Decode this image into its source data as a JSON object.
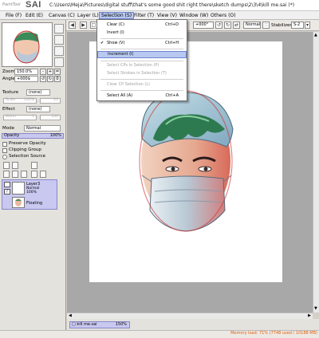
{
  "app": {
    "logo_small": "PaintTool",
    "logo_big": "SAI",
    "title": "C:\\Users\\Meja\\Pictures\\digital stuff\\that's some good shit right there\\sketch dumps\\2\\3\\4\\kill me.sai (*)"
  },
  "menu": [
    {
      "label": "File (F)"
    },
    {
      "label": "Edit (E)"
    },
    {
      "label": "Canvas (C)"
    },
    {
      "label": "Layer (L)"
    },
    {
      "label": "Selection (S)"
    },
    {
      "label": "Filter (T)"
    },
    {
      "label": "View (V)"
    },
    {
      "label": "Window (W)"
    },
    {
      "label": "Others (O)"
    }
  ],
  "toolbar": {
    "zoom_value": "+000°",
    "blend_mode": "Normal",
    "stabilizer_label": "Stabilizer",
    "stabilizer_value": "S-2"
  },
  "dropdown": {
    "items": [
      {
        "label": "Clear (C)",
        "shortcut": "Ctrl+D",
        "enabled": true
      },
      {
        "label": "Invert (I)",
        "shortcut": "",
        "enabled": true
      },
      {
        "label": "Show (V)",
        "shortcut": "Ctrl+H",
        "enabled": true,
        "checked": true
      },
      {
        "label": "Increment (I)",
        "shortcut": "",
        "enabled": true,
        "highlighted": true
      },
      {
        "label": "Select CPs in Selection (P)",
        "shortcut": "",
        "enabled": false
      },
      {
        "label": "Select Strokes in Selection (T)",
        "shortcut": "",
        "enabled": false
      },
      {
        "label": "Clear CP Selection (L)",
        "shortcut": "",
        "enabled": false
      },
      {
        "label": "Select All (A)",
        "shortcut": "Ctrl+A",
        "enabled": true
      }
    ]
  },
  "left": {
    "zoom_label": "Zoom",
    "zoom_value": "150.0%",
    "angle_label": "Angle",
    "angle_value": "+000$",
    "texture_label": "Texture",
    "texture_value": "(none)",
    "texture_scale": "Scale",
    "texture_scale_value": "100%",
    "texture_strength": "20",
    "effect_label": "Effect",
    "effect_value": "(none)",
    "effect_width": "Width",
    "effect_width_value": "1",
    "effect_strength": "100",
    "mode_label": "Mode",
    "mode_value": "Normal",
    "opacity_label": "Opacity",
    "opacity_value": "100%",
    "preserve_opacity": "Preserve Opacity",
    "clipping_group": "Clipping Group",
    "selection_source": "Selection Source"
  },
  "layers": [
    {
      "name": "Layer3",
      "mode": "Normal",
      "opacity": "100%"
    },
    {
      "name": "Floating"
    }
  ],
  "status": {
    "doc_name": "kill me.sai",
    "doc_zoom": "150%",
    "memory": "Memory load: 71% (7748 used / 10188 MB)"
  },
  "colors": {
    "accent": "#b8c8f0",
    "memory_text": "#e06010"
  }
}
